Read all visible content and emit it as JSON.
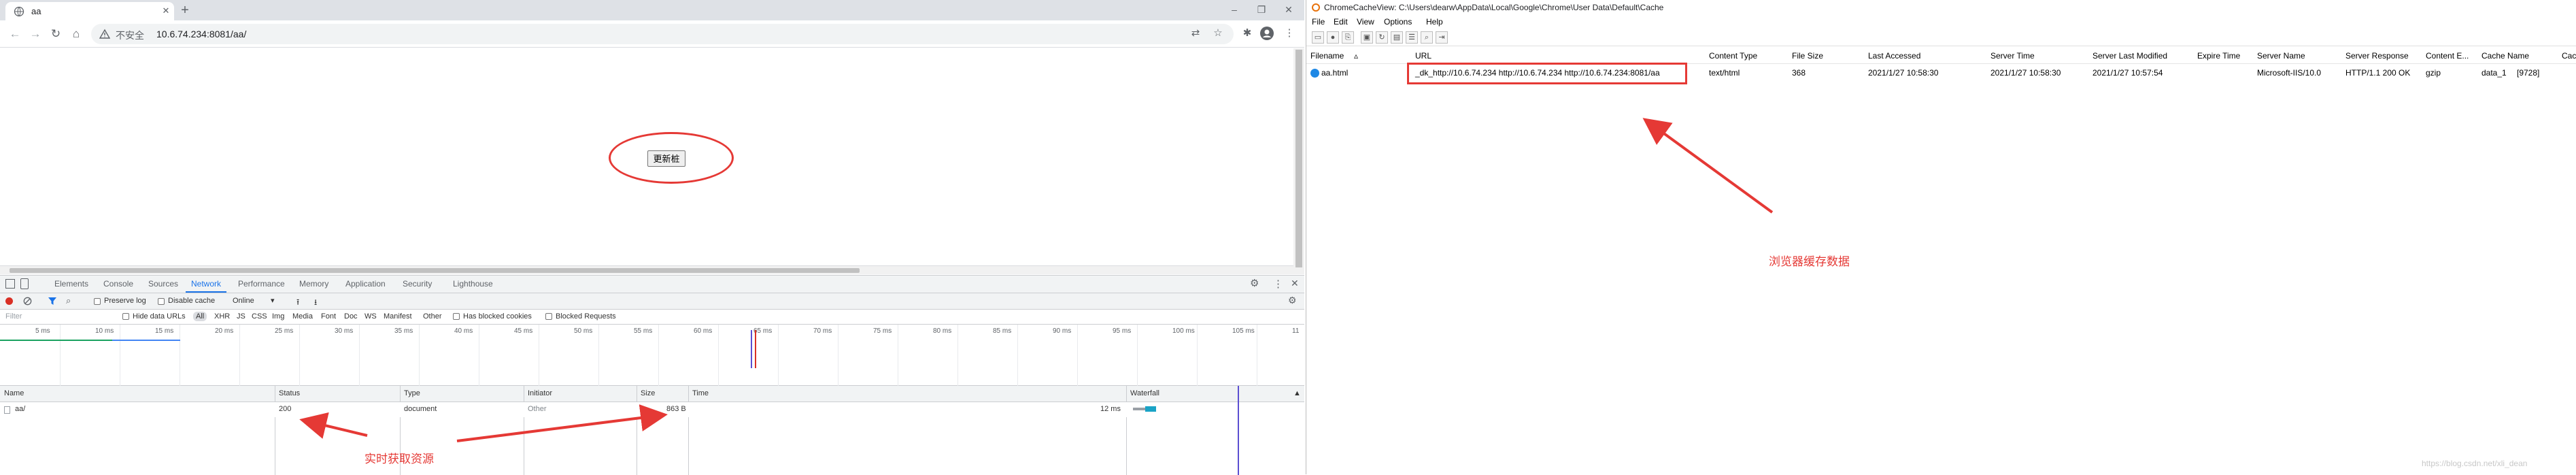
{
  "browser": {
    "tab_title": "aa",
    "insecure_label": "不安全",
    "url": "10.6.74.234:8081/aa/",
    "page": {
      "refresh_button_label": "更新桩"
    }
  },
  "devtools": {
    "tabs": [
      "Elements",
      "Console",
      "Sources",
      "Network",
      "Performance",
      "Memory",
      "Application",
      "Security",
      "Lighthouse"
    ],
    "active_tab": "Network",
    "preserve_log_label": "Preserve log",
    "disable_cache_label": "Disable cache",
    "throttle_value": "Online",
    "filter_placeholder": "Filter",
    "hide_data_urls_label": "Hide data URLs",
    "type_filters": [
      "All",
      "XHR",
      "JS",
      "CSS",
      "Img",
      "Media",
      "Font",
      "Doc",
      "WS",
      "Manifest",
      "Other"
    ],
    "has_blocked_cookies_label": "Has blocked cookies",
    "blocked_requests_label": "Blocked Requests",
    "timeline_ticks": [
      "5 ms",
      "10 ms",
      "15 ms",
      "20 ms",
      "25 ms",
      "30 ms",
      "35 ms",
      "40 ms",
      "45 ms",
      "50 ms",
      "55 ms",
      "60 ms",
      "65 ms",
      "70 ms",
      "75 ms",
      "80 ms",
      "85 ms",
      "90 ms",
      "95 ms",
      "100 ms",
      "105 ms",
      "11"
    ],
    "columns": [
      "Name",
      "Status",
      "Type",
      "Initiator",
      "Size",
      "Time",
      "Waterfall"
    ],
    "rows": [
      {
        "name": "aa/",
        "status": "200",
        "type": "document",
        "initiator": "Other",
        "size": "863 B",
        "time": "12 ms"
      }
    ]
  },
  "annotations": {
    "left_text": "实时获取资源",
    "right_text": "浏览器缓存数据",
    "color": "#e53935"
  },
  "ccv": {
    "title": "ChromeCacheView:  C:\\Users\\dearw\\AppData\\Local\\Google\\Chrome\\User Data\\Default\\Cache",
    "menu": [
      "File",
      "Edit",
      "View",
      "Options",
      "Help"
    ],
    "columns": [
      "Filename",
      "URL",
      "Content Type",
      "File Size",
      "Last Accessed",
      "Server Time",
      "Server Last Modified",
      "Expire Time",
      "Server Name",
      "Server Response",
      "Content E...",
      "Cache Name",
      "Cac"
    ],
    "rows": [
      {
        "filename": "aa.html",
        "url": "_dk_http://10.6.74.234 http://10.6.74.234 http://10.6.74.234:8081/aa",
        "content_type": "text/html",
        "file_size": "368",
        "last_accessed": "2021/1/27 10:58:30",
        "server_time": "2021/1/27 10:58:30",
        "server_last_modified": "2021/1/27 10:57:54",
        "expire_time": "",
        "server_name": "Microsoft-IIS/10.0",
        "server_response": "HTTP/1.1 200 OK",
        "content_encoding": "gzip",
        "cache_name": "data_1",
        "cac": "[9728]"
      }
    ],
    "watermark": "https://blog.csdn.net/xli_dean"
  }
}
